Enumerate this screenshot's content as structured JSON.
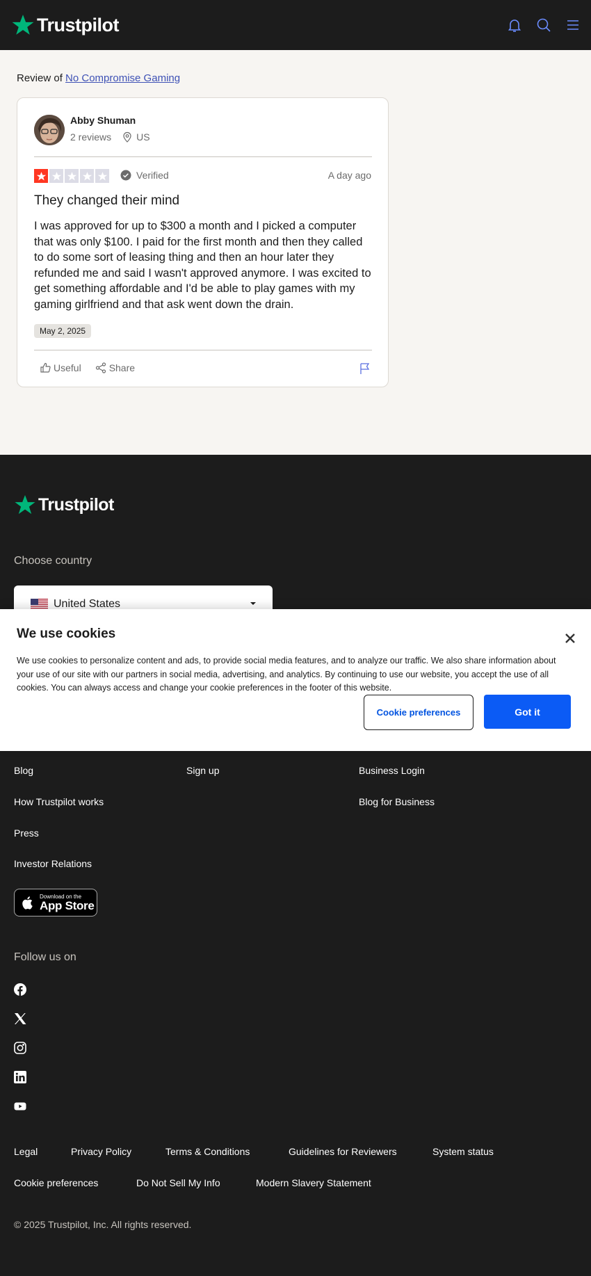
{
  "brand": {
    "name": "Trustpilot",
    "accent": "#00b67a",
    "header_bg": "#1c1c1c",
    "link_color": "#3e51b5"
  },
  "header": {
    "icons": [
      "bell-icon",
      "search-icon",
      "menu-icon"
    ]
  },
  "review_of": {
    "prefix": "Review of",
    "company": "No Compromise Gaming"
  },
  "review": {
    "author": "Abby Shuman",
    "reviews_count": "2 reviews",
    "country": "US",
    "rating": 1,
    "rating_max": 5,
    "verified_label": "Verified",
    "time_ago": "A day ago",
    "title": "They changed their mind",
    "body": "I was approved for up to $300 a month and I picked a computer that was only $100. I paid for the first month and then they called to do some sort of leasing thing and then an hour later they refunded me and said I wasn't approved anymore. I was excited to get something affordable and I'd be able to play games with my gaming girlfriend and that ask went down the drain.",
    "date": "May 2, 2025",
    "useful_label": "Useful",
    "share_label": "Share",
    "star_filled_color": "#ff3722",
    "star_empty_color": "#dcdce6"
  },
  "footer": {
    "choose_country": "Choose country",
    "country_selected": "United States",
    "links": {
      "col1": [
        "Blog",
        "How Trustpilot works",
        "Press",
        "Investor Relations"
      ],
      "col2": [
        "Sign up"
      ],
      "col3": [
        "Business Login",
        "Blog for Business"
      ]
    },
    "app_store": {
      "small": "Download on the",
      "big": "App Store"
    },
    "follow_us": "Follow us on",
    "social": [
      "facebook-icon",
      "x-icon",
      "instagram-icon",
      "linkedin-icon",
      "youtube-icon"
    ],
    "legal_row1": [
      "Legal",
      "Privacy Policy",
      "Terms & Conditions",
      "Guidelines for Reviewers",
      "System status"
    ],
    "legal_row2": [
      "Cookie preferences",
      "Do Not Sell My Info",
      "Modern Slavery Statement"
    ],
    "copyright": "© 2025 Trustpilot, Inc. All rights reserved."
  },
  "cookie_banner": {
    "title": "We use cookies",
    "text": "We use cookies to personalize content and ads, to provide social media features, and to analyze our traffic. We also share information about your use of our site with our partners in social media, advertising, and analytics. By continuing to use our website, you accept the use of all cookies. You can always access and change your cookie preferences in the footer of this website.",
    "preferences_button": "Cookie preferences",
    "accept_button": "Got it",
    "accept_color": "#0b5bf5"
  }
}
